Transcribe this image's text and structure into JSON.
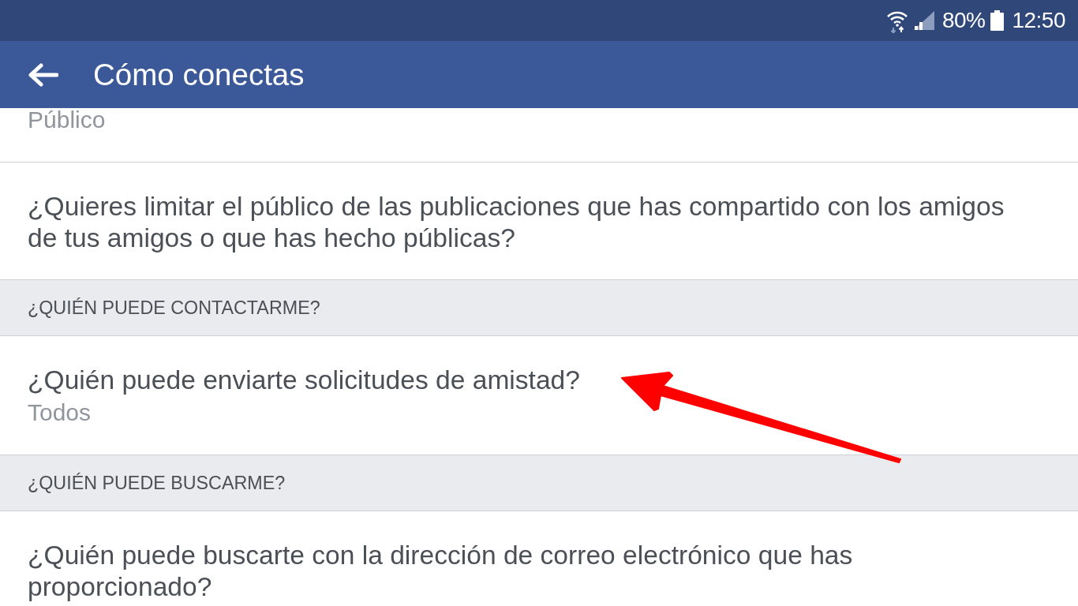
{
  "status_bar": {
    "battery": "80%",
    "time": "12:50"
  },
  "app_bar": {
    "title": "Cómo conectas"
  },
  "list": [
    {
      "kind": "setting",
      "subtitle": "Público"
    },
    {
      "kind": "setting",
      "title": "¿Quieres limitar el público de las publicaciones que has compartido con los amigos de tus amigos o que has hecho públicas?"
    },
    {
      "kind": "section",
      "title": "¿QUIÉN PUEDE CONTACTARME?"
    },
    {
      "kind": "setting",
      "title": "¿Quién puede enviarte solicitudes de amistad?",
      "subtitle": "Todos"
    },
    {
      "kind": "section",
      "title": "¿QUIÉN PUEDE BUSCARME?"
    },
    {
      "kind": "setting",
      "title": "¿Quién puede buscarte con la dirección de correo electrónico que has proporcionado?"
    }
  ],
  "annotation": {
    "kind": "arrow"
  }
}
